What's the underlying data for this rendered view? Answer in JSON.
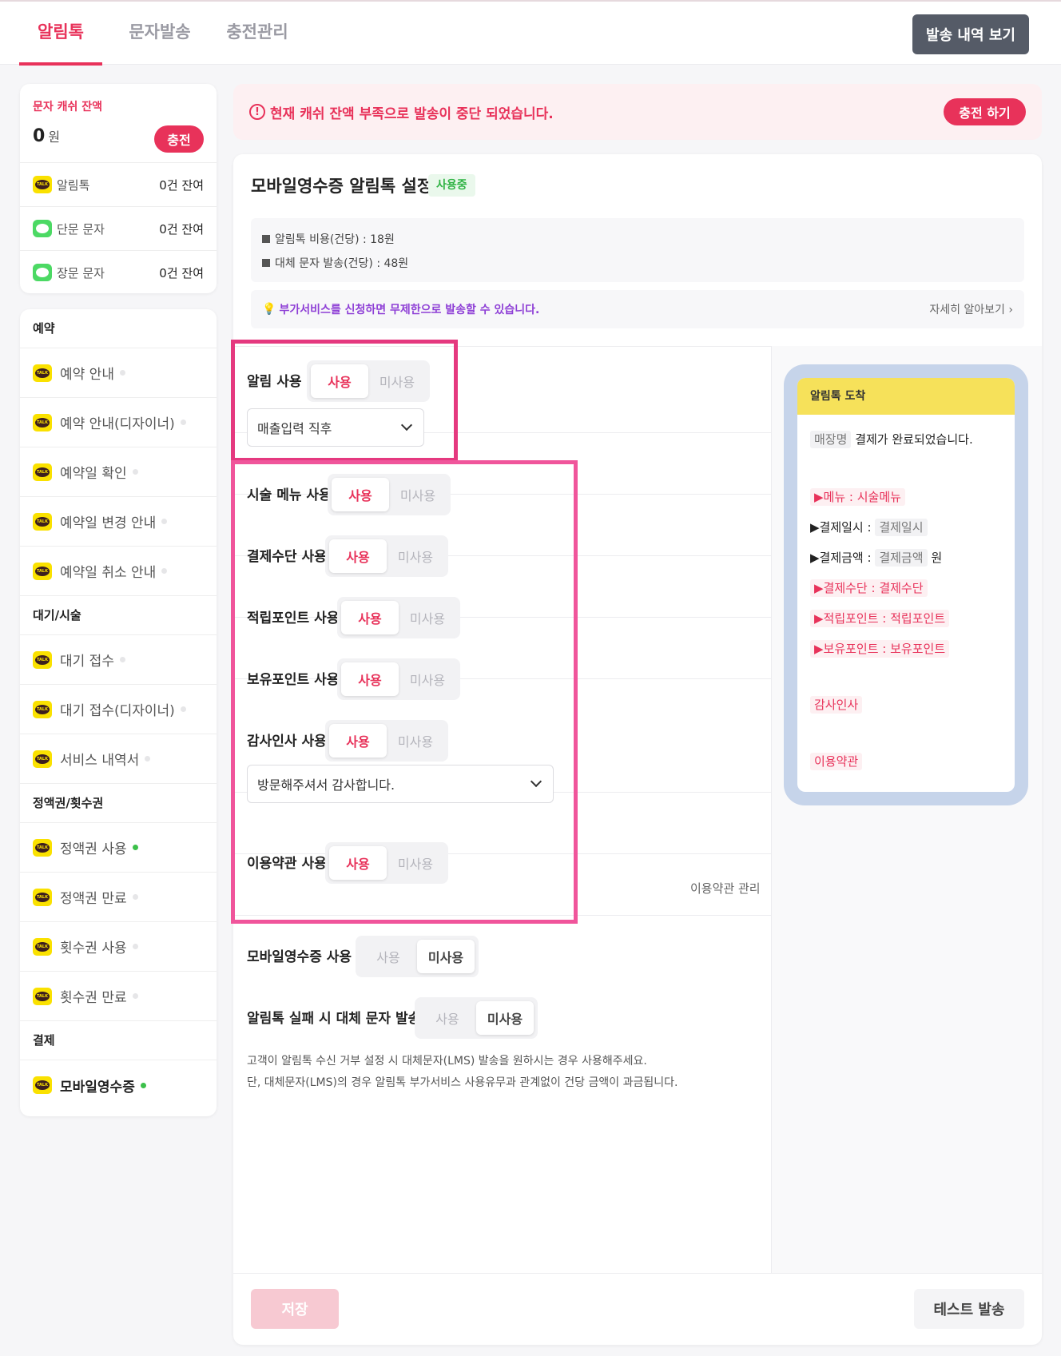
{
  "tabs": [
    {
      "label": "알림톡",
      "active": true
    },
    {
      "label": "문자발송",
      "active": false
    },
    {
      "label": "충전관리",
      "active": false
    }
  ],
  "header": {
    "history_button": "발송 내역 보기"
  },
  "balance": {
    "title": "문자 캐쉬 잔액",
    "amount": "0",
    "unit": "원",
    "charge_button": "충전",
    "rows": [
      {
        "icon": "kakao-talk-icon",
        "name": "알림톡",
        "count": "0건 잔여"
      },
      {
        "icon": "sms-bubble-icon",
        "name": "단문 문자",
        "count": "0건 잔여"
      },
      {
        "icon": "sms-bubble-icon",
        "name": "장문 문자",
        "count": "0건 잔여"
      }
    ]
  },
  "menu": {
    "sections": [
      {
        "title": "예약",
        "items": [
          {
            "label": "예약 안내",
            "on": false
          },
          {
            "label": "예약 안내(디자이너)",
            "on": false
          },
          {
            "label": "예약일 확인",
            "on": false
          },
          {
            "label": "예약일 변경 안내",
            "on": false
          },
          {
            "label": "예약일 취소 안내",
            "on": false
          }
        ]
      },
      {
        "title": "대기/시술",
        "items": [
          {
            "label": "대기 접수",
            "on": false
          },
          {
            "label": "대기 접수(디자이너)",
            "on": false
          },
          {
            "label": "서비스 내역서",
            "on": false
          }
        ]
      },
      {
        "title": "정액권/횟수권",
        "items": [
          {
            "label": "정액권 사용",
            "on": true
          },
          {
            "label": "정액권 만료",
            "on": false
          },
          {
            "label": "횟수권 사용",
            "on": false
          },
          {
            "label": "횟수권 만료",
            "on": false
          }
        ]
      },
      {
        "title": "결제",
        "items": [
          {
            "label": "모바일영수증",
            "on": true,
            "active": true
          }
        ]
      }
    ]
  },
  "alert": {
    "icon": "exclamation-circle-icon",
    "text": "현재 캐쉬 잔액 부족으로 발송이 중단 되었습니다.",
    "button": "충전 하기"
  },
  "main": {
    "title": "모바일영수증 알림톡 설정",
    "status": "사용중",
    "info": [
      "알림톡 비용(건당) : 18원",
      "대체 문자 발송(건당) : 48원"
    ],
    "tip": "부가서비스를 신청하면 무제한으로 발송할 수 있습니다.",
    "tip_link": "자세히 알아보기 ›",
    "options": {
      "notify": {
        "label": "알림 사용",
        "on": "사용",
        "off": "미사용",
        "selected": "on"
      },
      "notify_timing": "매출입력 직후",
      "menu": {
        "label": "시술 메뉴 사용",
        "on": "사용",
        "off": "미사용",
        "selected": "on"
      },
      "payment": {
        "label": "결제수단 사용",
        "on": "사용",
        "off": "미사용",
        "selected": "on"
      },
      "points_earned": {
        "label": "적립포인트 사용",
        "on": "사용",
        "off": "미사용",
        "selected": "on"
      },
      "points_held": {
        "label": "보유포인트 사용",
        "on": "사용",
        "off": "미사용",
        "selected": "on"
      },
      "thanks": {
        "label": "감사인사 사용",
        "on": "사용",
        "off": "미사용",
        "selected": "on"
      },
      "thanks_message": "방문해주셔서 감사합니다.",
      "terms": {
        "label": "이용약관 사용",
        "on": "사용",
        "off": "미사용",
        "selected": "on"
      },
      "terms_link": "이용약관 관리",
      "receipt": {
        "label": "모바일영수증 사용",
        "on": "사용",
        "off": "미사용",
        "selected": "off"
      },
      "fallback": {
        "label": "알림톡 실패 시 대체 문자 발송",
        "on": "사용",
        "off": "미사용",
        "selected": "off"
      }
    },
    "note": [
      "고객이 알림톡 수신 거부 설정 시 대체문자(LMS) 발송을 원하시는 경우 사용해주세요.",
      "단, 대체문자(LMS)의 경우 알림톡 부가서비스 사용유무과 관계없이 건당 금액이 과금됩니다."
    ],
    "save_button": "저장",
    "test_button": "테스트 발송"
  },
  "preview": {
    "header": "알림톡 도착",
    "store_tag": "매장명",
    "complete_text": "결제가 완료되었습니다.",
    "menu_line": "▶메뉴 : 시술메뉴",
    "date_label": "▶결제일시 : ",
    "date_tag": "결제일시",
    "amount_label": "▶결제금액 : ",
    "amount_tag": "결제금액",
    "amount_unit": "원",
    "payment_line": "▶결제수단 : 결제수단",
    "earned_line": "▶적립포인트 : 적립포인트",
    "held_line": "▶보유포인트 : 보유포인트",
    "thanks": "감사인사",
    "terms": "이용약관"
  },
  "colors": {
    "accent": "#e8325a",
    "highlight_border": "#e5397f",
    "kakao_yellow": "#fae100",
    "active_dot": "#3cc04a"
  }
}
